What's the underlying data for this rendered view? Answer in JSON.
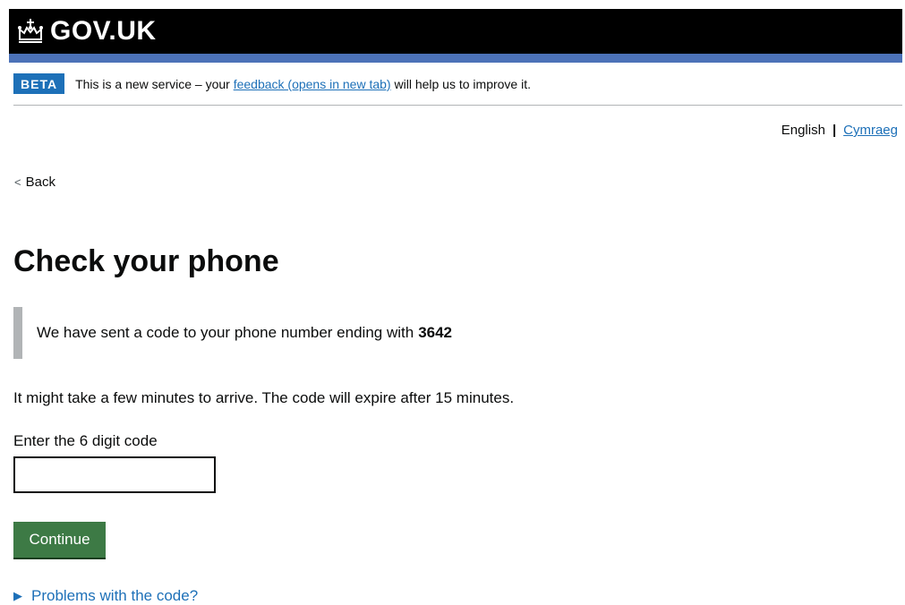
{
  "header": {
    "logo_text": "GOV.UK"
  },
  "phase_banner": {
    "tag": "BETA",
    "text_before": "This is a new service – your",
    "link_text": "feedback (opens in new tab)",
    "text_after": "will help us to improve it."
  },
  "language": {
    "current": "English",
    "separator": "|",
    "alternative": "Cymraeg"
  },
  "back_link": {
    "label": "Back"
  },
  "main": {
    "title": "Check your phone",
    "inset_text": "We have sent a code to your phone number ending with",
    "phone_suffix": "3642",
    "info_text": "It might take a few minutes to arrive. The code will expire after 15 minutes.",
    "code_label": "Enter the 6 digit code",
    "code_value": "",
    "continue_label": "Continue",
    "problems_label": "Problems with the code?"
  },
  "colors": {
    "header_bg": "#000000",
    "brand_blue": "#1d70b8",
    "button_green": "#3d7a45",
    "inset_border": "#b1b4b6"
  }
}
